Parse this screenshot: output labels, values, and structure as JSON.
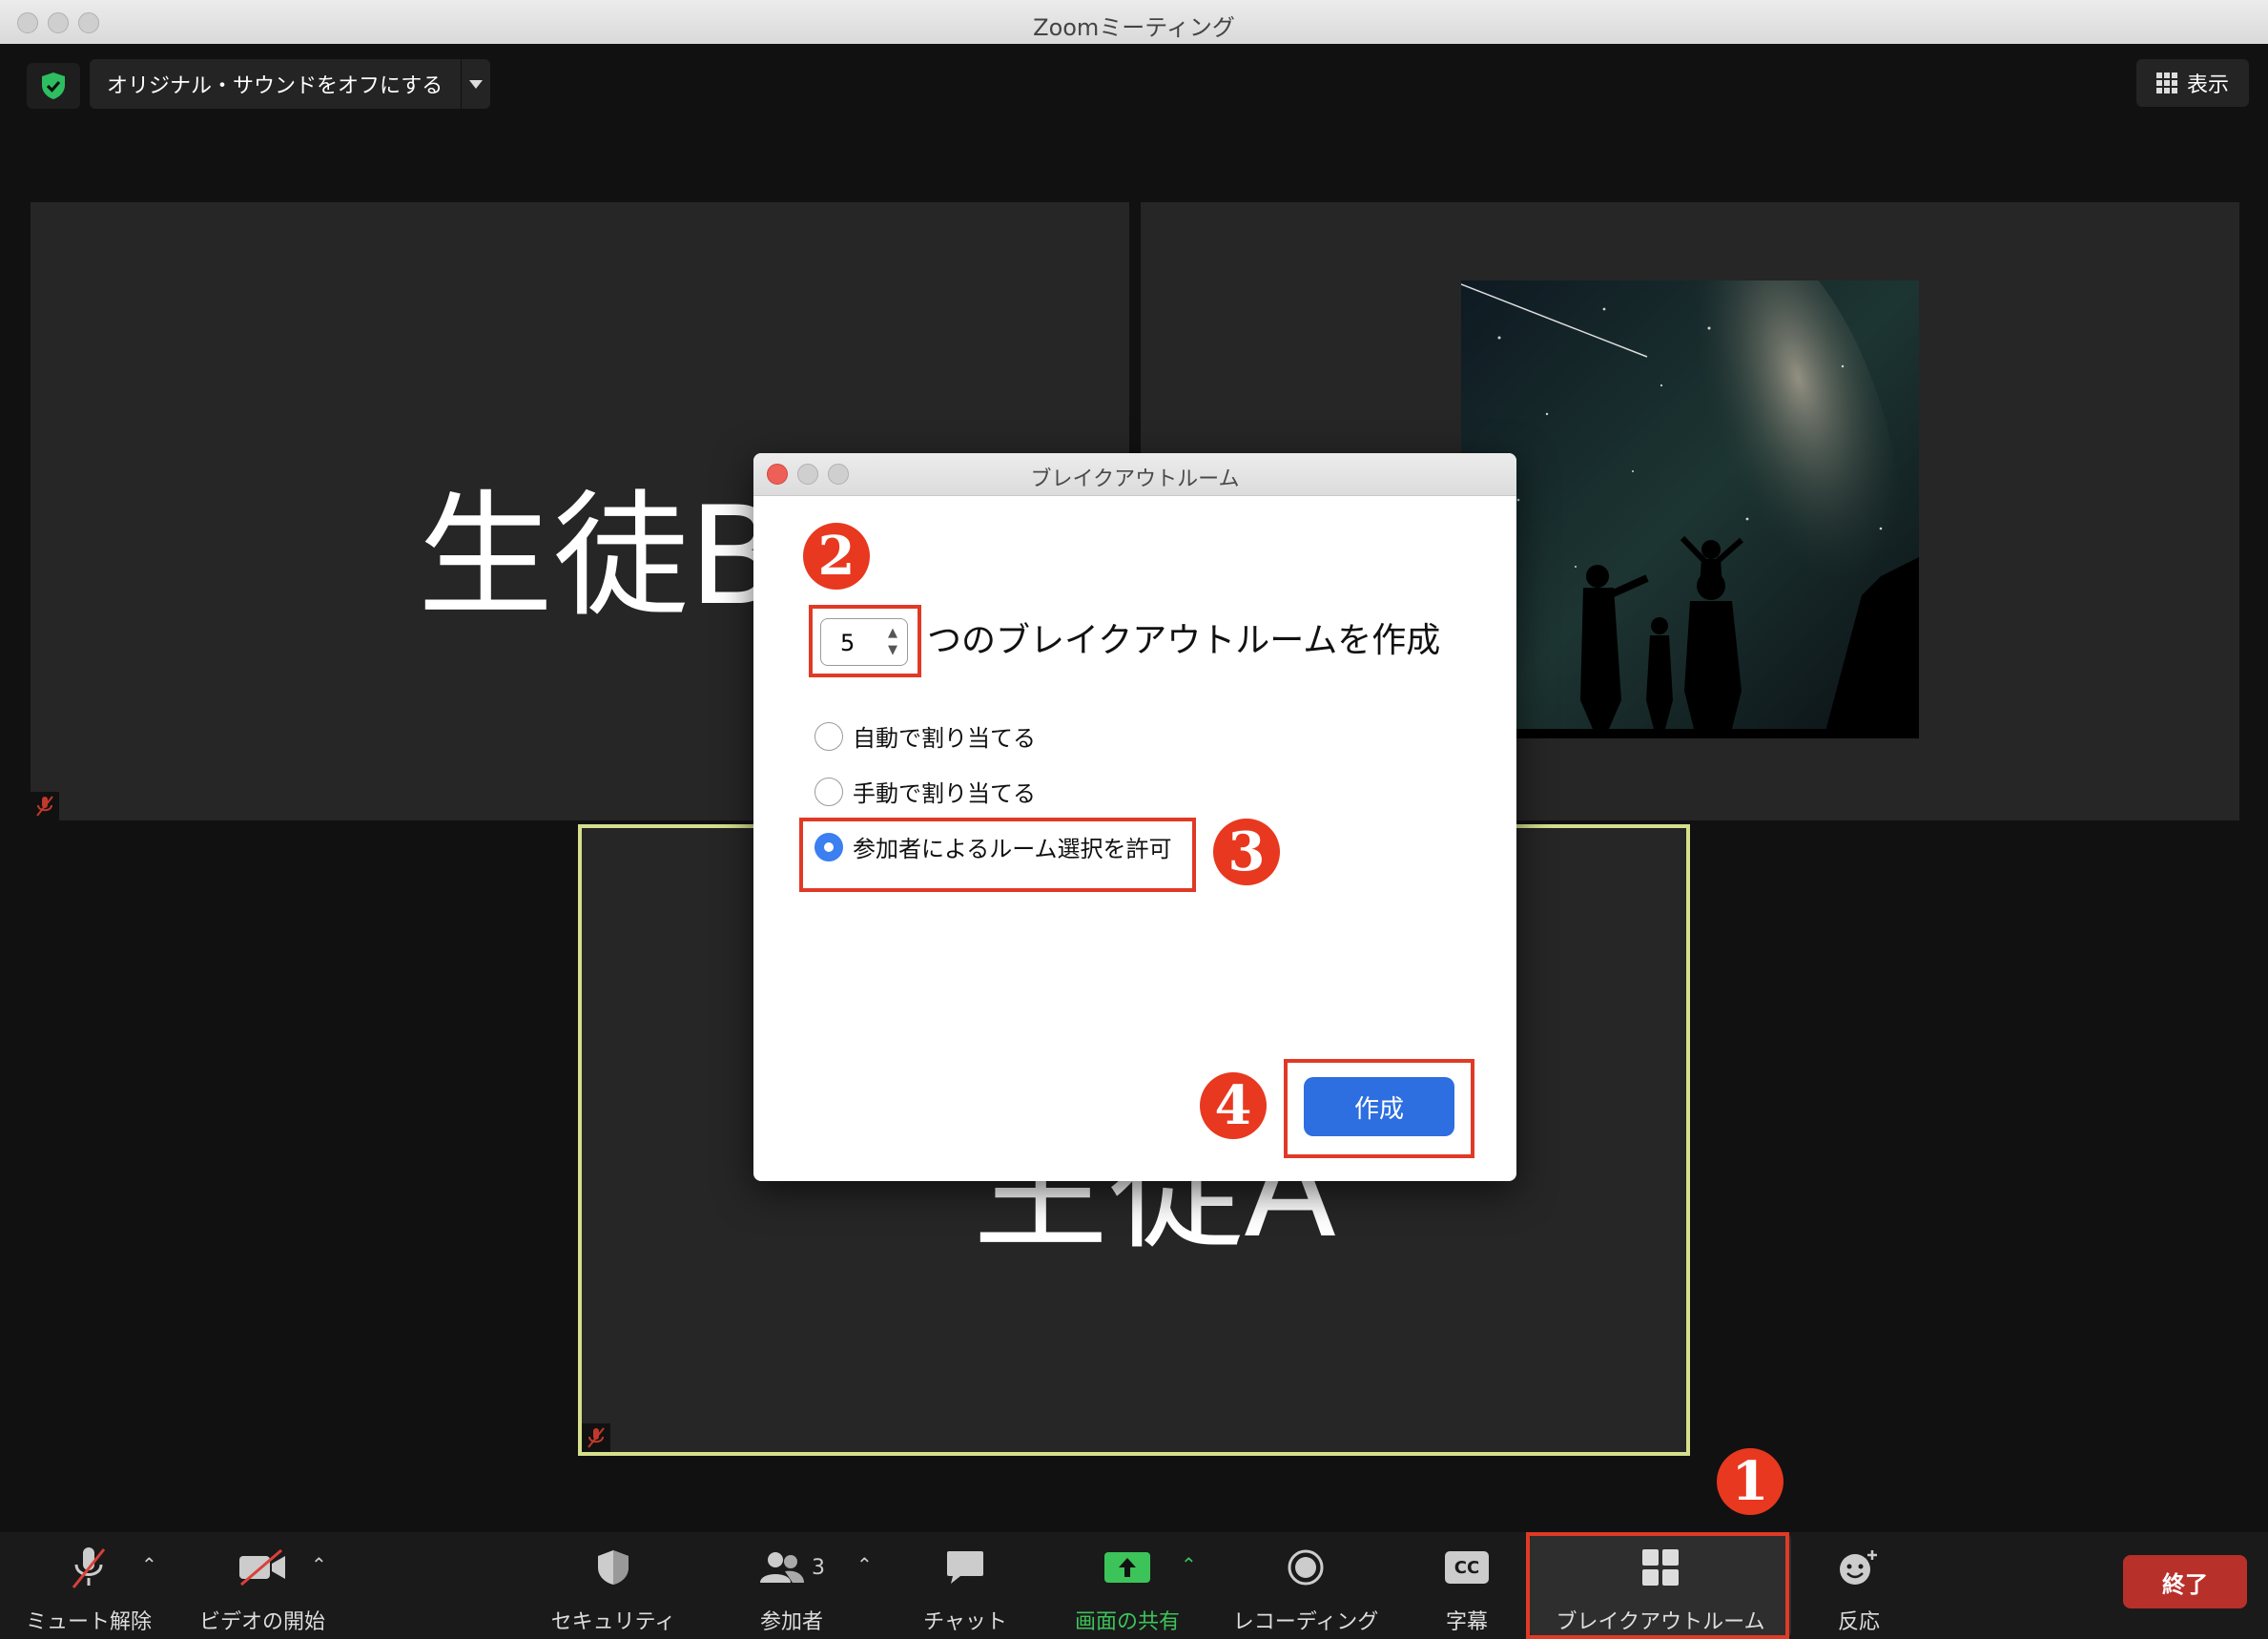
{
  "window": {
    "title": "Zoomミーティング"
  },
  "top_bar": {
    "sound_toggle_label": "オリジナル・サウンドをオフにする",
    "view_label": "表示"
  },
  "tiles": {
    "student_b": {
      "name": "生徒B"
    },
    "student_a": {
      "name": "生徒A"
    }
  },
  "dialog": {
    "title": "ブレイクアウトルーム",
    "room_count": "5",
    "create_label": "つのブレイクアウトルームを作成",
    "options": [
      {
        "label": "自動で割り当てる",
        "selected": false
      },
      {
        "label": "手動で割り当てる",
        "selected": false
      },
      {
        "label": "参加者によるルーム選択を許可",
        "selected": true
      }
    ],
    "create_button": "作成"
  },
  "steps": {
    "one": "1",
    "two": "2",
    "three": "3",
    "four": "4"
  },
  "toolbar": {
    "mute": "ミュート解除",
    "video": "ビデオの開始",
    "security": "セキュリティ",
    "participants": "参加者",
    "participant_count": "3",
    "chat": "チャット",
    "share": "画面の共有",
    "record": "レコーディング",
    "cc": "字幕",
    "cc_icon_text": "CC",
    "breakout": "ブレイクアウトルーム",
    "reactions": "反応",
    "end": "終了"
  },
  "colors": {
    "accent_blue": "#2d6ee0",
    "annotation_red": "#e03a26",
    "share_green": "#3cc35a",
    "active_speaker_border": "#d6e08c",
    "end_red": "#b8302a"
  }
}
